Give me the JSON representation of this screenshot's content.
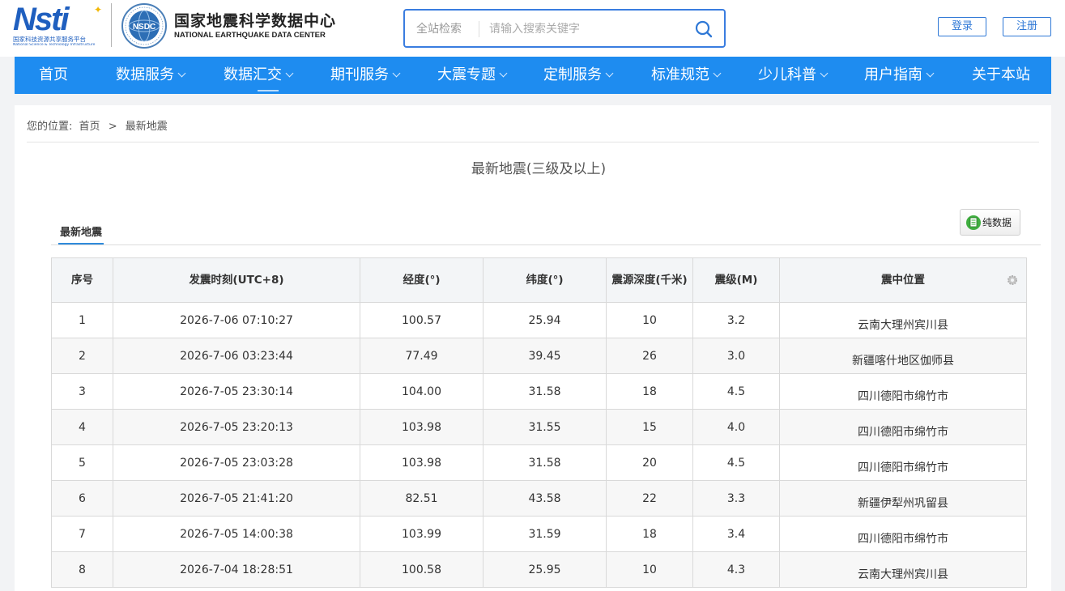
{
  "header": {
    "logo_nsti_word": "Nsti",
    "logo_nsti_cn": "国家科技资源共享服务平台",
    "logo_nsti_en": "National Science & Technology Infrastructure",
    "seal_text": "NSDC",
    "site_title_cn": "国家地震科学数据中心",
    "site_title_en": "NATIONAL EARTHQUAKE DATA CENTER",
    "search": {
      "scope": "全站检索",
      "placeholder": "请输入搜索关键字"
    },
    "login_label": "登录",
    "register_label": "注册"
  },
  "nav": {
    "items": [
      {
        "label": "首页",
        "dropdown": false
      },
      {
        "label": "数据服务",
        "dropdown": true
      },
      {
        "label": "数据汇交",
        "dropdown": true
      },
      {
        "label": "期刊服务",
        "dropdown": true
      },
      {
        "label": "大震专题",
        "dropdown": true
      },
      {
        "label": "定制服务",
        "dropdown": true
      },
      {
        "label": "标准规范",
        "dropdown": true
      },
      {
        "label": "少儿科普",
        "dropdown": true
      },
      {
        "label": "用户指南",
        "dropdown": true
      },
      {
        "label": "关于本站",
        "dropdown": false
      }
    ],
    "active_index": 2,
    "bg_color": "#1e8cf0"
  },
  "breadcrumb": {
    "prefix": "您的位置:",
    "home": "首页",
    "separator": ">",
    "current": "最新地震"
  },
  "page_title": "最新地震(三级及以上)",
  "tab_label": "最新地震",
  "raw_data_button": "纯数据",
  "table": {
    "columns": [
      "序号",
      "发震时刻(UTC+8)",
      "经度(°)",
      "纬度(°)",
      "震源深度(千米)",
      "震级(M)",
      "震中位置"
    ],
    "rows": [
      [
        "1",
        "2026-7-06 07:10:27",
        "100.57",
        "25.94",
        "10",
        "3.2",
        "云南大理州宾川县"
      ],
      [
        "2",
        "2026-7-06 03:23:44",
        "77.49",
        "39.45",
        "26",
        "3.0",
        "新疆喀什地区伽师县"
      ],
      [
        "3",
        "2026-7-05 23:30:14",
        "104.00",
        "31.58",
        "18",
        "4.5",
        "四川德阳市绵竹市"
      ],
      [
        "4",
        "2026-7-05 23:20:13",
        "103.98",
        "31.55",
        "15",
        "4.0",
        "四川德阳市绵竹市"
      ],
      [
        "5",
        "2026-7-05 23:03:28",
        "103.98",
        "31.58",
        "20",
        "4.5",
        "四川德阳市绵竹市"
      ],
      [
        "6",
        "2026-7-05 21:41:20",
        "82.51",
        "43.58",
        "22",
        "3.3",
        "新疆伊犁州巩留县"
      ],
      [
        "7",
        "2026-7-05 14:00:38",
        "103.99",
        "31.59",
        "18",
        "3.4",
        "四川德阳市绵竹市"
      ],
      [
        "8",
        "2026-7-04 18:28:51",
        "100.58",
        "25.95",
        "10",
        "4.3",
        "云南大理州宾川县"
      ]
    ]
  }
}
